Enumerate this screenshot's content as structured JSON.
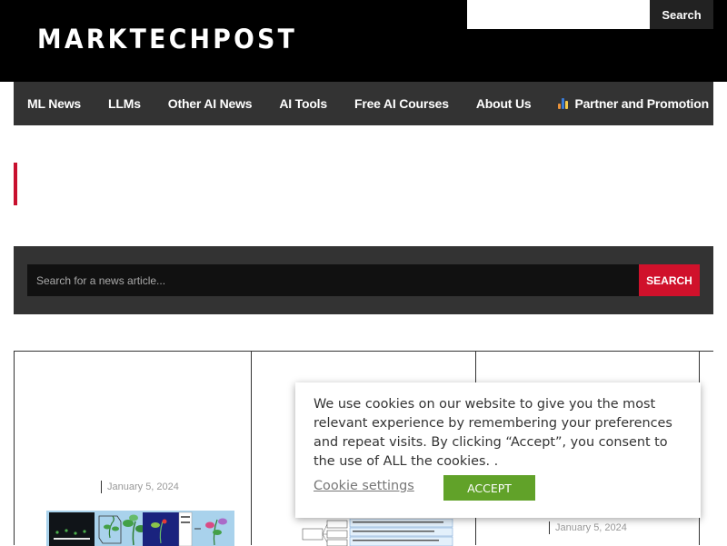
{
  "header": {
    "logo_text": "MARKTECHPOST",
    "search_placeholder": "",
    "search_button_label": "Search"
  },
  "nav": {
    "items": [
      {
        "label": "ML News"
      },
      {
        "label": "LLMs"
      },
      {
        "label": "Other AI News"
      },
      {
        "label": "AI Tools"
      },
      {
        "label": "Free AI Courses"
      },
      {
        "label": "About Us"
      },
      {
        "label": "Partner and Promotion",
        "icon": "bar-chart-icon"
      }
    ]
  },
  "news_search": {
    "placeholder": "Search for a news article...",
    "button_label": "SEARCH"
  },
  "cards": [
    {
      "date": "January 5, 2024"
    },
    {
      "date": ""
    },
    {
      "date": "January 5, 2024"
    }
  ],
  "cookie_banner": {
    "message": "We use cookies on our website to give you the most relevant experience by remembering your preferences and repeat visits. By clicking “Accept”, you consent to the use of ALL the cookies. .",
    "settings_label": "Cookie settings",
    "accept_label": "ACCEPT"
  },
  "colors": {
    "header_bg": "#000000",
    "nav_bg": "#333333",
    "accent_red": "#d0112b",
    "accept_green": "#61a229"
  }
}
